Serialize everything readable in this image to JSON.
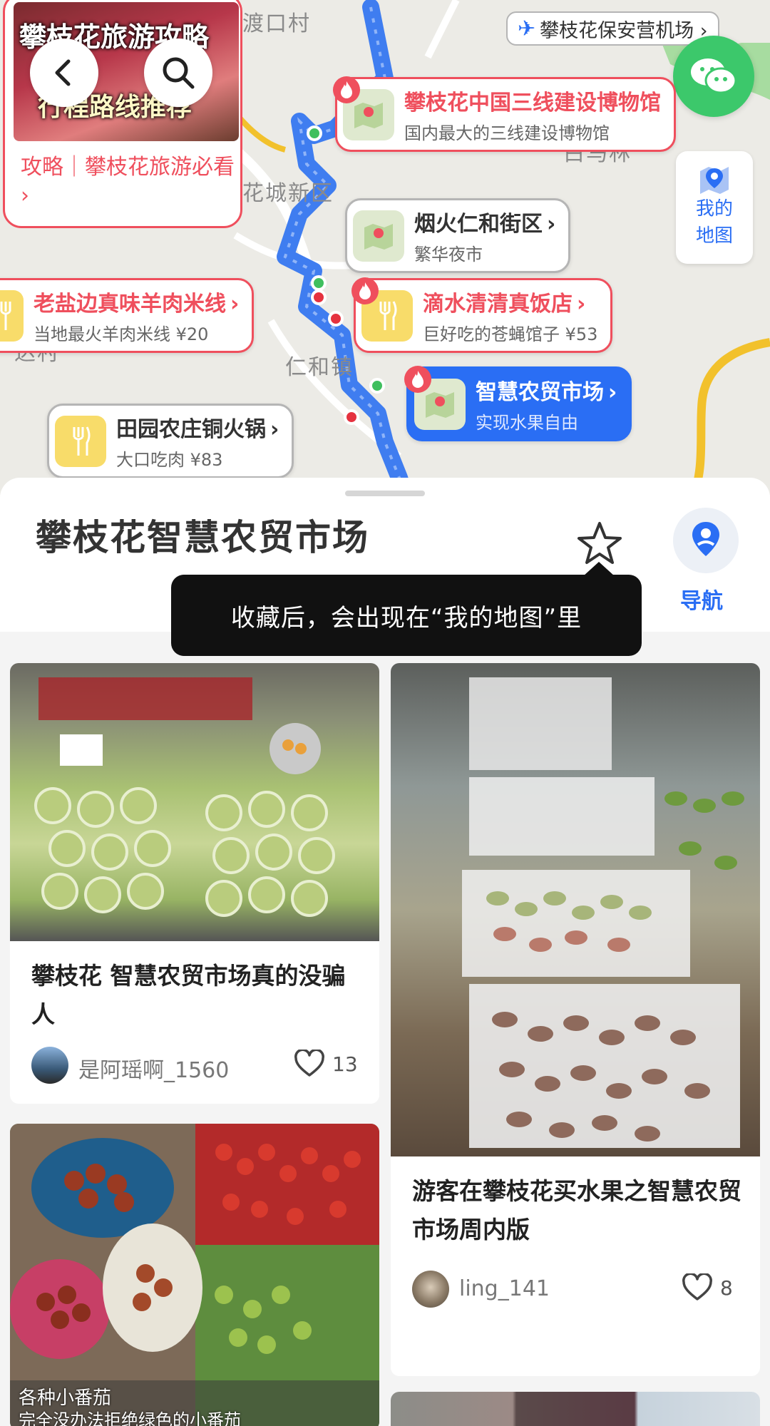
{
  "map": {
    "labels": {
      "dukou": "渡口村",
      "huacheng": "花城新区",
      "renhe": "仁和",
      "renhe_town": "仁和镇",
      "dacun": "达村",
      "yimenshu": "白马林",
      "panzhi": "攀枝"
    },
    "guide_card": {
      "image_title": "攀枝花旅游攻略",
      "image_subtitle": "行程路线推荐",
      "text": "攻略｜攀枝花旅游必看 ›"
    },
    "airport": "攀枝花保安营机场 ›",
    "my_map": "我的地图",
    "pois": [
      {
        "title": "攀枝花中国三线建设博物馆",
        "subtitle": "国内最大的三线建设博物馆"
      },
      {
        "title": "烟火仁和街区",
        "subtitle": "繁华夜市"
      },
      {
        "title": "老盐边真味羊肉米线",
        "subtitle": "当地最火羊肉米线 ¥20"
      },
      {
        "title": "滴水清清真饭店",
        "subtitle": "巨好吃的苍蝇馆子 ¥53"
      },
      {
        "title": "智慧农贸市场",
        "subtitle": "实现水果自由"
      },
      {
        "title": "田园农庄铜火锅",
        "subtitle": "大口吃肉 ¥83"
      }
    ],
    "colors": {
      "route": "#3f7df0",
      "poi_red": "#ef4f5d",
      "poi_blue": "#2a6ef4",
      "wechat": "#3cc86b"
    }
  },
  "sheet": {
    "title": "攀枝花智慧农贸市场",
    "nav_label": "导航",
    "tooltip": "收藏后，会出现在“我的地图”里"
  },
  "posts": [
    {
      "title": "攀枝花 智慧农贸市场真的没骗人",
      "author": "是阿瑶啊_1560",
      "likes": "13",
      "image_desc": "番荔枝摊位"
    },
    {
      "title": "游客在攀枝花买水果之智慧农贸市场周内版",
      "author": "ling_141",
      "likes": "8",
      "image_desc": "芒果摊位"
    },
    {
      "title": "",
      "author": "",
      "likes": "",
      "image_overlay": "各种小番茄",
      "image_overlay2": "完全没办法拒绝绿色的小番茄"
    }
  ]
}
